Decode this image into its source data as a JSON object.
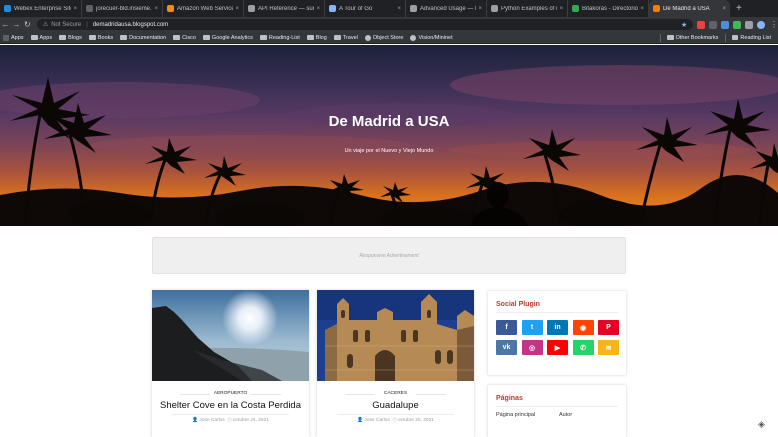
{
  "browser": {
    "tabs": [
      {
        "title": "Webex Enterprise Site",
        "color": "#1d8ce0"
      },
      {
        "title": "jorecuer-bld.insieme.lo",
        "color": "#5f6368"
      },
      {
        "title": "Amazon Web Services",
        "color": "#f38b1f"
      },
      {
        "title": "API Reference — sure",
        "color": "#9aa0a6"
      },
      {
        "title": "A Tour of Go",
        "color": "#8ab4f8"
      },
      {
        "title": "Advanced Usage — Re",
        "color": "#9aa0a6"
      },
      {
        "title": "Python Examples of url",
        "color": "#9aa0a6"
      },
      {
        "title": "Bitakoras - Directorio d",
        "color": "#34a853"
      },
      {
        "title": "De Madrid a USA",
        "color": "#f57d00"
      }
    ],
    "address": {
      "security_label": "Not Secure",
      "url": "demadridausa.blogspot.com"
    },
    "bookmarks": [
      {
        "label": "Apps",
        "kind": "grid"
      },
      {
        "label": "Apps",
        "kind": "folder"
      },
      {
        "label": "Blogs",
        "kind": "folder"
      },
      {
        "label": "Books",
        "kind": "folder"
      },
      {
        "label": "Documentation",
        "kind": "folder"
      },
      {
        "label": "Cisco",
        "kind": "folder"
      },
      {
        "label": "Google Analytics",
        "kind": "folder"
      },
      {
        "label": "Reading-List",
        "kind": "folder"
      },
      {
        "label": "Blog",
        "kind": "folder"
      },
      {
        "label": "Travel",
        "kind": "folder"
      },
      {
        "label": "Object Store",
        "kind": "gear"
      },
      {
        "label": "Vision/Mininet",
        "kind": "gear"
      }
    ],
    "other_bookmarks": "Other Bookmarks",
    "reading_list": "Reading List"
  },
  "hero": {
    "title": "De Madrid a USA",
    "subtitle": "Un viaje por el Nuevo y Viejo Mundo"
  },
  "ad": {
    "label": "Responsive Advertisement"
  },
  "posts": [
    {
      "category": "AEROPUERTO",
      "title": "Shelter Cove en la Costa Perdida",
      "author": "Jose Carlos",
      "date": "octubre 24, 2021"
    },
    {
      "category": "CÁCERES",
      "title": "Guadalupe",
      "author": "Jose Carlos",
      "date": "octubre 20, 2021"
    }
  ],
  "sidebar": {
    "social_title": "Social Plugin",
    "social": [
      {
        "name": "facebook",
        "glyph": "f",
        "color": "#3b5998"
      },
      {
        "name": "twitter",
        "glyph": "t",
        "color": "#1da1f2"
      },
      {
        "name": "linkedin",
        "glyph": "in",
        "color": "#0077b5"
      },
      {
        "name": "reddit",
        "glyph": "◉",
        "color": "#ff4500"
      },
      {
        "name": "pinterest",
        "glyph": "P",
        "color": "#e60023"
      },
      {
        "name": "vk",
        "glyph": "vk",
        "color": "#4a76a8"
      },
      {
        "name": "instagram",
        "glyph": "◎",
        "color": "#c13584"
      },
      {
        "name": "youtube",
        "glyph": "▶",
        "color": "#ff0000"
      },
      {
        "name": "whatsapp",
        "glyph": "✆",
        "color": "#25d366"
      },
      {
        "name": "rss",
        "glyph": "≋",
        "color": "#f8b41a"
      }
    ],
    "pages_title": "Páginas",
    "pages": [
      "Página principal",
      "Autor"
    ]
  }
}
